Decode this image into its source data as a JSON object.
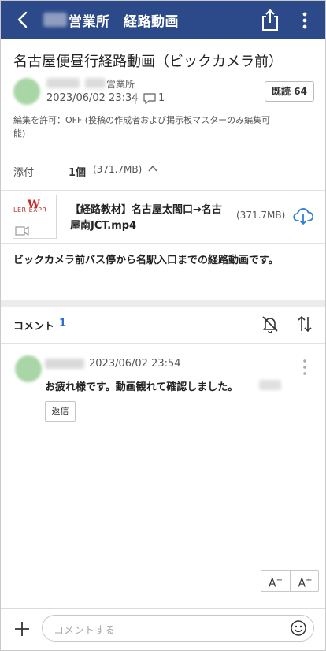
{
  "header": {
    "title": "営業所　経路動画",
    "back_icon": "chevron-left-icon",
    "share_icon": "share-icon",
    "more_icon": "more-vertical-icon",
    "bg_color": "#2c4a8a"
  },
  "post": {
    "title": "名古屋便昼行経路動画（ビックカメラ前）",
    "author_dept": "営業所",
    "date": "2023/06/02 23:34",
    "comment_count": "1",
    "read_badge": "既読 64",
    "edit_note": "編集を許可：OFF (投稿の作成者および掲示板マスターのみ編集可能)",
    "body": "ビックカメラ前バス停から名駅入口までの経路動画です。"
  },
  "attachment": {
    "label": "添付",
    "count": "1個",
    "total_size": "(371.7MB)",
    "file": {
      "name": "【経路教材】名古屋太閤口→名古屋南JCT.mp4",
      "size": "(371.7MB)",
      "thumb_text": "LER EXPR",
      "thumb_logo": "W"
    }
  },
  "comments": {
    "title": "コメント",
    "count": "1",
    "items": [
      {
        "date": "2023/06/02 23:54",
        "text": "お疲れ様です。動画観れて確認しました。",
        "reply_label": "返信"
      }
    ]
  },
  "font_size": {
    "minus_label": "A",
    "minus_sup": "−",
    "plus_label": "A",
    "plus_sup": "+"
  },
  "footer": {
    "placeholder": "コメントする"
  },
  "colors": {
    "accent": "#2c6fd1",
    "header_bg": "#2c4a8a"
  }
}
